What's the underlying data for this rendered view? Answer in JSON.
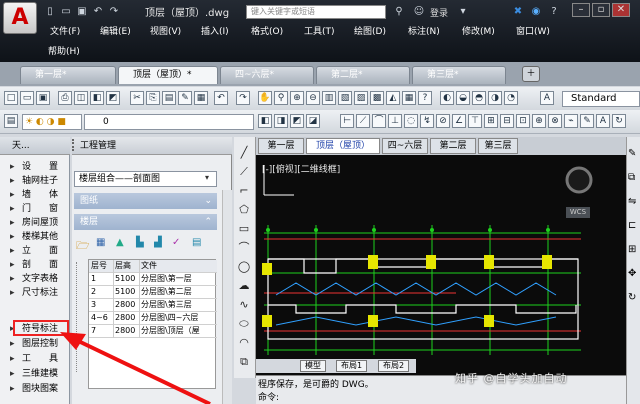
{
  "app": {
    "doc_title": "顶层（屋顶）.dwg",
    "search_placeholder": "键入关键字或短语",
    "login": "登录"
  },
  "menu": [
    "文件(F)",
    "编辑(E)",
    "视图(V)",
    "插入(I)",
    "格式(O)",
    "工具(T)",
    "绘图(D)",
    "标注(N)",
    "修改(M)",
    "窗口(W)",
    "帮助(H)"
  ],
  "doc_tabs": [
    "第一层*",
    "顶层（屋顶）*",
    "四~六层*",
    "第二层*",
    "第三层*"
  ],
  "toolbar": {
    "text_style": "Standard",
    "layer": "0"
  },
  "left_panel": {
    "header": "天...",
    "items": [
      "设　　置",
      "轴网柱子",
      "墙　　体",
      "门　　窗",
      "房间屋顶",
      "楼梯其他",
      "立　　面",
      "剖　　面",
      "文字表格",
      "尺寸标注",
      "符号标注",
      "图层控制",
      "工　　具",
      "三维建模",
      "图块图案"
    ]
  },
  "project_manager": {
    "title": "工程管理",
    "group_combo": "楼层组合——剖面图",
    "sections": [
      "图纸",
      "楼层"
    ],
    "table": {
      "headers": [
        "层号",
        "层高",
        "文件"
      ],
      "rows": [
        [
          "1",
          "5100",
          "分层图\\第一层"
        ],
        [
          "2",
          "5100",
          "分层图\\第二层"
        ],
        [
          "3",
          "2800",
          "分层图\\第三层"
        ],
        [
          "4~6",
          "2800",
          "分层图\\四~六层"
        ],
        [
          "7",
          "2800",
          "分层图\\顶层（屋"
        ]
      ]
    }
  },
  "canvas": {
    "tabs": [
      "第一层",
      "顶层（屋顶）",
      "四~六层",
      "第二层",
      "第三层"
    ],
    "viewport_label": "[-][俯视][二维线框]",
    "wcs": "WCS"
  },
  "layout_tabs": [
    "模型",
    "布局1",
    "布局2"
  ],
  "command": {
    "line1": "程序保存，是可爵的 DWG。",
    "line2": "命令:"
  },
  "watermark": "知乎 @自学头加自动"
}
